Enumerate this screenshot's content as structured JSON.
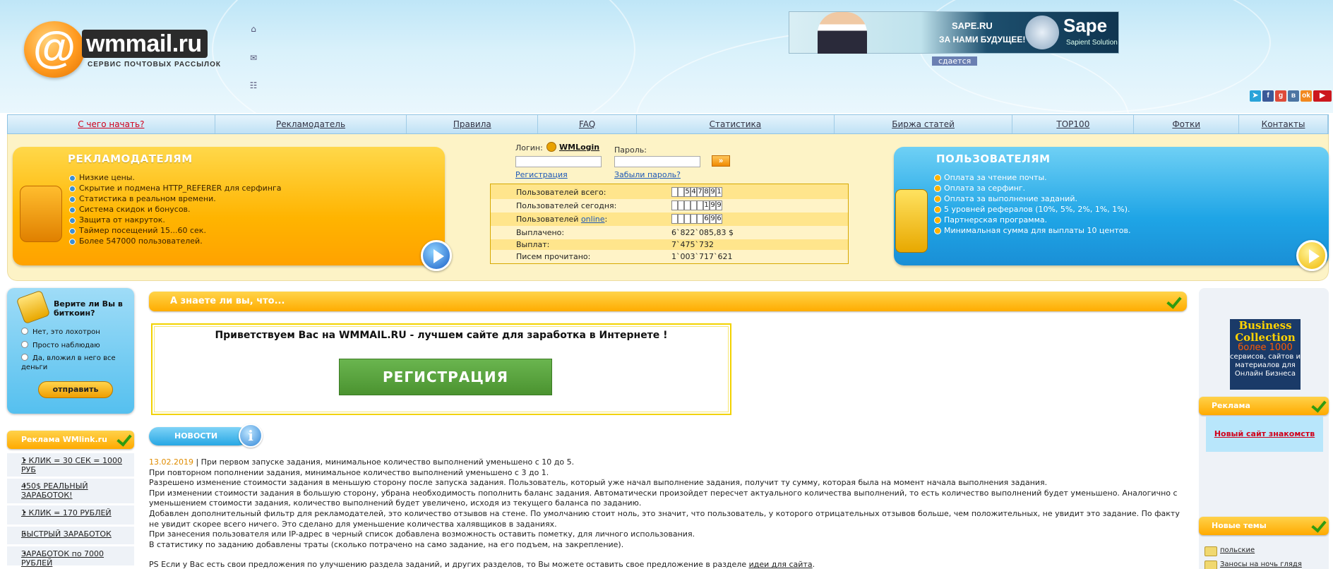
{
  "header": {
    "logo_at": "@",
    "logo_name": "wmmail.ru",
    "logo_tagline": "СЕРВИС ПОЧТОВЫХ РАССЫЛОК",
    "banner": {
      "line1": "SAPE.RU",
      "line2": "ЗА НАМИ БУДУЩЕЕ!",
      "brand": "Sape",
      "brand_sub": "Sapient Solution"
    },
    "banner_status": "сдается",
    "social_icons": [
      "telegram-icon",
      "facebook-icon",
      "google-plus-icon",
      "vk-icon",
      "odnoklassniki-icon",
      "youtube-icon"
    ]
  },
  "nav": {
    "items": [
      {
        "label": "С чего начать?",
        "w": 294
      },
      {
        "label": "Рекламодатель",
        "w": 272
      },
      {
        "label": "Правила",
        "w": 186
      },
      {
        "label": "FAQ",
        "w": 140
      },
      {
        "label": "Статистика",
        "w": 280
      },
      {
        "label": "Биржа статей",
        "w": 253
      },
      {
        "label": "TOP100",
        "w": 172
      },
      {
        "label": "Фотки",
        "w": 149
      },
      {
        "label": "Контакты",
        "w": 126
      }
    ]
  },
  "advertisers": {
    "title": "РЕКЛАМОДАТЕЛЯМ",
    "items": [
      "Низкие цены.",
      "Скрытие и подмена HTTP_REFERER для серфинга",
      "Статистика в реальном времени.",
      "Система скидок и бонусов.",
      "Защита от накруток.",
      "Таймер посещений 15...60 сек.",
      "Более 547000 пользователей."
    ]
  },
  "users": {
    "title": "ПОЛЬЗОВАТЕЛЯМ",
    "items": [
      "Оплата за чтение почты.",
      "Оплата за серфинг.",
      "Оплата за выполнение заданий.",
      "5 уровней рефералов (10%, 5%, 2%, 1%, 1%).",
      "Партнерская программа.",
      "Минимальная сумма для выплаты 10 центов."
    ]
  },
  "login": {
    "login_label": "Логин:",
    "wmlogin": "WMLogin",
    "password_label": "Пароль:",
    "register_link": "Регистрация",
    "forgot_link": "Забыли пароль?",
    "go": "»"
  },
  "stats": {
    "total_label": "Пользователей всего:",
    "total_digits": [
      "",
      "",
      "5",
      "4",
      "7",
      "8",
      "9",
      "1"
    ],
    "today_label": "Пользователей сегодня:",
    "today_digits": [
      "",
      "",
      "",
      "",
      "",
      "1",
      "9",
      "9"
    ],
    "online_label_pre": "Пользователей ",
    "online_link": "online",
    "online_label_post": ":",
    "online_digits": [
      "",
      "",
      "",
      "",
      "",
      "6",
      "9",
      "6"
    ],
    "paid_label": "Выплачено:",
    "paid_value": "6`822`085,83 $",
    "payouts_label": "Выплат:",
    "payouts_value": "7`475`732",
    "letters_label": "Писем прочитано:",
    "letters_value": "1`003`717`621"
  },
  "poll": {
    "question": "Верите ли Вы в биткоин?",
    "options": [
      "Нет, это лохотрон",
      "Просто наблюдаю",
      "Да, вложил в него все деньги"
    ],
    "submit": "отправить"
  },
  "wmlink": {
    "title": "Реклама WMlink.ru",
    "items": [
      "1 КЛИК = 30 СЕК = 1000 РУБ",
      "450$ РЕАЛЬНЫЙ ЗАРАБОТОК!",
      "1 КЛИК = 170 РУБЛЕЙ",
      "БЫСТРЫЙ ЗАРАБОТОК",
      "ЗАРАБОТОК  по  7000  РУБЛЕЙ"
    ]
  },
  "center": {
    "did_you_know": "А знаете ли вы, что...",
    "welcome": "Приветствуем Вас на WMMAIL.RU - лучшем сайте для заработка в Интернете !",
    "register_button": "РЕГИСТРАЦИЯ",
    "news_title": "НОВОСТИ",
    "news_date": "13.02.2019",
    "news_first": " | При первом запуске задания, минимальное количество выполнений уменьшено с 10 до 5.",
    "news_lines": [
      "При повторном пополнении задания, минимальное количество выполнений уменьшено с 3 до 1.",
      "Разрешено изменение стоимости задания в меньшую сторону после запуска задания. Пользователь, который уже начал выполнение задания, получит ту сумму, которая была на момент начала выполнения задания.",
      "При изменении стоимости задания в большую сторону, убрана необходимость пополнить баланс задания. Автоматически произойдет пересчет актуального количества выполнений, то есть количество выполнений будет уменьшено. Аналогично с уменьшением стоимости задания, количество выполнений будет увеличено, исходя из текущего баланса по заданию.",
      "Добавлен дополнительный фильтр для рекламодателей, это количество отзывов на стене. По умолчанию стоит ноль, это значит, что пользователь, у которого отрицательных отзывов больше, чем положительных, не увидит это задание. По факту не увидит скорее всего ничего. Это сделано для уменьшение количества халявщиков в заданиях.",
      "При занесения пользователя или IP-адрес в черный список добавлена возможность оставить пометку, для личного использования.",
      "В статистику по заданию добавлены траты (сколько потрачено на само задание, на его подъем, на закрепление)."
    ],
    "ps_text": "PS Если у Вас есть свои предложения по улучшению раздела заданий, и других разделов, то Вы можете оставить свое предложение в разделе ",
    "ps_link": "идеи для сайта",
    "ps_end": "."
  },
  "right": {
    "bc_title1": "Business",
    "bc_title2": "Collection",
    "bc_more": "более 1000",
    "bc_desc": "сервисов, сайтов и материалов для Онлайн Бизнеса",
    "ad_title": "Реклама",
    "ad_link": "Новый сайт знакомств",
    "topics_title": "Новые темы",
    "topics": [
      "польские",
      "Заносы на ночь глядя"
    ]
  }
}
